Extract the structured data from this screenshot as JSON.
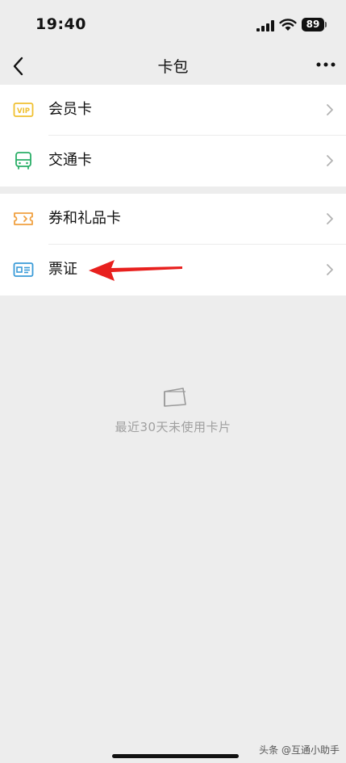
{
  "status_bar": {
    "time": "19:40",
    "battery": "89"
  },
  "nav": {
    "title": "卡包"
  },
  "groups": [
    {
      "items": [
        {
          "label": "会员卡",
          "icon": "vip-card-icon"
        },
        {
          "label": "交通卡",
          "icon": "bus-icon"
        }
      ]
    },
    {
      "items": [
        {
          "label": "券和礼品卡",
          "icon": "coupon-icon"
        },
        {
          "label": "票证",
          "icon": "ticket-id-icon"
        }
      ]
    }
  ],
  "empty_state": {
    "text": "最近30天未使用卡片",
    "icon": "card-icon"
  },
  "watermark": "头条 @互通小助手",
  "colors": {
    "vip": "#f0c030",
    "bus": "#2aae67",
    "coupon": "#f0a040",
    "ticket": "#3a9bd8",
    "annotation": "#e8201e"
  }
}
